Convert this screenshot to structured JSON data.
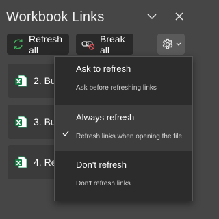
{
  "header": {
    "title": "Workbook Links",
    "collapse_icon": "chevron-down-icon",
    "close_icon": "close-icon"
  },
  "toolbar": {
    "refresh_all_label": "Refresh all",
    "refresh_all_icon": "refresh-icon",
    "break_all_label": "Break all",
    "break_all_icon": "break-link-icon",
    "settings_icon": "gear-icon",
    "settings_menu_icon": "chevron-down-icon"
  },
  "links": [
    {
      "label": "2. Bu",
      "icon": "excel-file-icon"
    },
    {
      "label": "3. Bu",
      "icon": "excel-file-icon"
    },
    {
      "label": "4. Re",
      "icon": "excel-file-icon"
    }
  ],
  "menu": {
    "items": [
      {
        "title": "Ask to refresh",
        "desc": "Ask before refreshing links",
        "selected": false
      },
      {
        "title": "Always refresh",
        "desc": "Refresh links when opening the file",
        "selected": true
      },
      {
        "title": "Don't refresh",
        "desc": "Don't refresh links",
        "selected": false
      }
    ]
  },
  "colors": {
    "background": "#464646",
    "button": "#292929",
    "menu": "#2c2c2c",
    "excel_green": "#21a366",
    "refresh_green": "#3fae5a",
    "break_red": "#e0555b"
  }
}
